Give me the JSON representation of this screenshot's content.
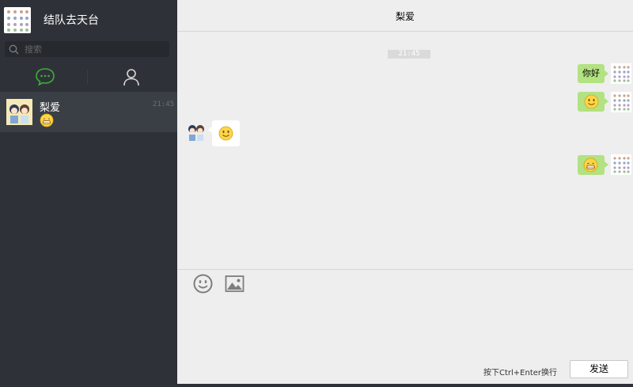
{
  "user": {
    "name": "结队去天台"
  },
  "search": {
    "placeholder": "搜索"
  },
  "tabs": {
    "chat_icon": "chat-bubble-icon",
    "contacts_icon": "person-icon"
  },
  "conversations": [
    {
      "name": "梨爱",
      "time": "21:45",
      "preview_icon": "grinning-face-emoji"
    }
  ],
  "chat": {
    "title": "梨爱",
    "time_divider": "21:45",
    "messages": [
      {
        "side": "right",
        "type": "text",
        "text": "你好"
      },
      {
        "side": "right",
        "type": "emoji",
        "emoji": "smiley-face"
      },
      {
        "side": "left",
        "type": "emoji",
        "emoji": "smiley-face"
      },
      {
        "side": "right",
        "type": "emoji",
        "emoji": "grinning-face"
      }
    ]
  },
  "composer": {
    "emoji_icon": "smiley-icon",
    "image_icon": "image-icon",
    "hint": "按下Ctrl+Enter换行",
    "send_label": "发送"
  },
  "colors": {
    "sidebar": "#2e3238",
    "selected_item": "#3a3f45",
    "main_bg": "#eeeeee",
    "bubble_self": "#b2e281",
    "bubble_other": "#ffffff",
    "accent": "#3caf36"
  }
}
